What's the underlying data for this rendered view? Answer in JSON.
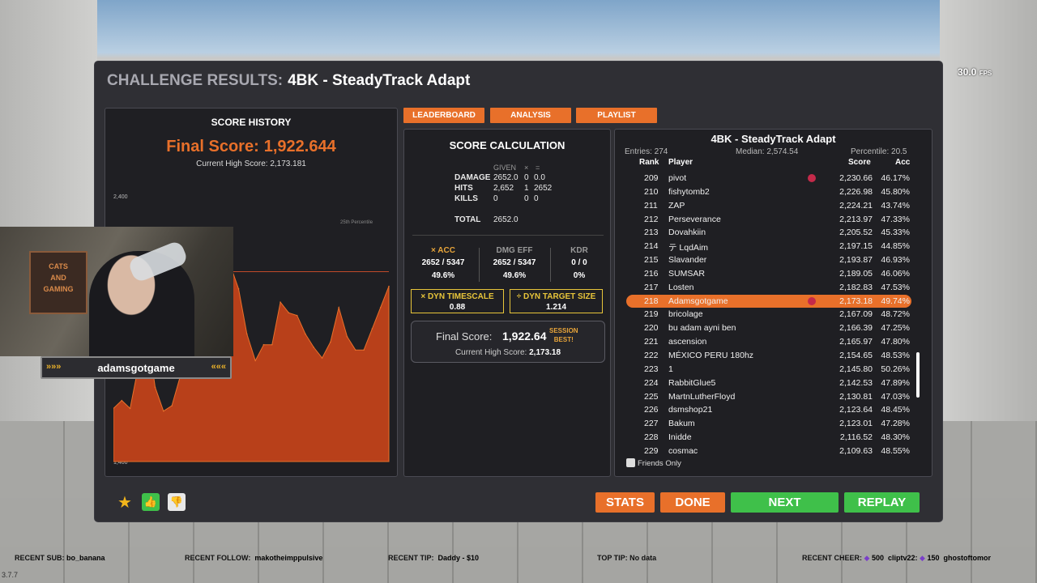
{
  "hud": {
    "fps_value": "30.0",
    "fps_unit": "FPS",
    "version": "3.7.7"
  },
  "panel": {
    "title_prefix": "CHALLENGE RESULTS:",
    "scenario": "4BK - SteadyTrack Adapt"
  },
  "tabs": {
    "leaderboard": "LEADERBOARD",
    "analysis": "ANALYSIS",
    "playlist": "PLAYLIST"
  },
  "history": {
    "title": "SCORE HISTORY",
    "final_label": "Final Score:",
    "final_value": "1,922.644",
    "high_label": "Current High Score:",
    "high_value": "2,173.181",
    "percentile_label": "25th Percentile"
  },
  "chart_data": {
    "type": "area",
    "title": "",
    "xlabel": "",
    "ylabel": "",
    "ylim": [
      1400,
      2400
    ],
    "y_ticks": [
      "2,400",
      "1,600",
      "1,400"
    ],
    "reference_line": {
      "label": "25th Percentile",
      "value": 2115
    },
    "series": [
      {
        "values": [
          1600,
          1630,
          1600,
          1760,
          1900,
          1680,
          1590,
          1610,
          1720,
          2000,
          2050,
          1940,
          1900,
          2070,
          2140,
          2050,
          1880,
          1780,
          1840,
          1840,
          2000,
          1960,
          1950,
          1880,
          1830,
          1790,
          1850,
          1980,
          1870,
          1820,
          1820,
          1900,
          1980,
          2060
        ]
      }
    ]
  },
  "calc": {
    "title": "SCORE CALCULATION",
    "head_given": "GIVEN",
    "head_x": "×",
    "head_eq": "=",
    "rows": [
      {
        "label": "DAMAGE",
        "given": "2652.0",
        "mult": "0",
        "result": "0.0"
      },
      {
        "label": "HITS",
        "given": "2,652",
        "mult": "1",
        "result": "2652"
      },
      {
        "label": "KILLS",
        "given": "0",
        "mult": "0",
        "result": "0"
      }
    ],
    "total_label": "TOTAL",
    "total_value": "2652.0",
    "acc": {
      "head": "× ACC",
      "v1": "2652 / 5347",
      "v2": "49.6%"
    },
    "dmg": {
      "head": "DMG EFF",
      "v1": "2652 / 5347",
      "v2": "49.6%"
    },
    "kdr": {
      "head": "KDR",
      "v1": "0 / 0",
      "v2": "0%"
    },
    "timescale": {
      "label": "× DYN TIMESCALE",
      "value": "0.88"
    },
    "target": {
      "label": "÷ DYN TARGET SIZE",
      "value": "1.214"
    },
    "final_label": "Final Score:",
    "final_value": "1,922.64",
    "session_best_1": "SESSION",
    "session_best_2": "BEST!",
    "high_label": "Current High Score:",
    "high_value": "2,173.18"
  },
  "leaderboard": {
    "title": "4BK - SteadyTrack Adapt",
    "entries": "Entries: 274",
    "median": "Median: 2,574.54",
    "percentile": "Percentile: 20.5",
    "col_rank": "Rank",
    "col_player": "Player",
    "col_score": "Score",
    "col_acc": "Acc",
    "friends_only": "Friends Only",
    "rows": [
      {
        "rank": "209",
        "player": "pivot",
        "score": "2,230.66",
        "acc": "46.17%",
        "icon": true
      },
      {
        "rank": "210",
        "player": "fishytomb2",
        "score": "2,226.98",
        "acc": "45.80%"
      },
      {
        "rank": "211",
        "player": "ZAP",
        "score": "2,224.21",
        "acc": "43.74%"
      },
      {
        "rank": "212",
        "player": "Perseverance",
        "score": "2,213.97",
        "acc": "47.33%"
      },
      {
        "rank": "213",
        "player": "Dovahkiin",
        "score": "2,205.52",
        "acc": "45.33%"
      },
      {
        "rank": "214",
        "player": "テ LqdAim",
        "score": "2,197.15",
        "acc": "44.85%"
      },
      {
        "rank": "215",
        "player": "Slavander",
        "score": "2,193.87",
        "acc": "46.93%"
      },
      {
        "rank": "216",
        "player": "SUMSAR",
        "score": "2,189.05",
        "acc": "46.06%"
      },
      {
        "rank": "217",
        "player": "Losten",
        "score": "2,182.83",
        "acc": "47.53%"
      },
      {
        "rank": "218",
        "player": "Adamsgotgame",
        "score": "2,173.18",
        "acc": "49.74%",
        "icon": true,
        "me": true
      },
      {
        "rank": "219",
        "player": "bricolage",
        "score": "2,167.09",
        "acc": "48.72%"
      },
      {
        "rank": "220",
        "player": "bu adam ayni ben",
        "score": "2,166.39",
        "acc": "47.25%"
      },
      {
        "rank": "221",
        "player": "ascension",
        "score": "2,165.97",
        "acc": "47.80%"
      },
      {
        "rank": "222",
        "player": "MÉXICO PERU 180hz",
        "score": "2,154.65",
        "acc": "48.53%"
      },
      {
        "rank": "223",
        "player": "1",
        "score": "2,145.80",
        "acc": "50.26%"
      },
      {
        "rank": "224",
        "player": "RabbitGlue5",
        "score": "2,142.53",
        "acc": "47.89%"
      },
      {
        "rank": "225",
        "player": "MartnLutherFloyd",
        "score": "2,130.81",
        "acc": "47.03%"
      },
      {
        "rank": "226",
        "player": "dsmshop21",
        "score": "2,123.64",
        "acc": "48.45%"
      },
      {
        "rank": "227",
        "player": "Bakum",
        "score": "2,123.01",
        "acc": "47.28%"
      },
      {
        "rank": "228",
        "player": "Inidde",
        "score": "2,116.52",
        "acc": "48.30%"
      },
      {
        "rank": "229",
        "player": "cosmac",
        "score": "2,109.63",
        "acc": "48.55%"
      }
    ]
  },
  "buttons": {
    "stats": "STATS",
    "done": "DONE",
    "next": "NEXT",
    "replay": "REPLAY"
  },
  "icons": {
    "star": "star-icon",
    "thumbs_up": "thumbs-up-icon",
    "thumbs_down": "thumbs-down-icon"
  },
  "colors": {
    "accent": "#e8702a",
    "green": "#3fc04a",
    "gold": "#e8c53a",
    "panel": "#2f2f34"
  },
  "webcam": {
    "username": "adamsgotgame",
    "poster_line1": "CATS",
    "poster_line2": "AND",
    "poster_line3": "GAMING"
  },
  "ticker": {
    "sub_label": "RECENT SUB:",
    "sub_value": "bo_banana",
    "follow_label": "RECENT FOLLOW:",
    "follow_value": "makotheimppulsive",
    "tip_label": "RECENT TIP:",
    "tip_value": "Daddy - $10",
    "top_tip": "TOP TIP: No data",
    "cheer_label": "RECENT CHEER:",
    "cheer1_amount": "500",
    "cheer1_user": "cliptv22:",
    "cheer2_amount": "150",
    "cheer2_user": "ghostoftomor"
  }
}
